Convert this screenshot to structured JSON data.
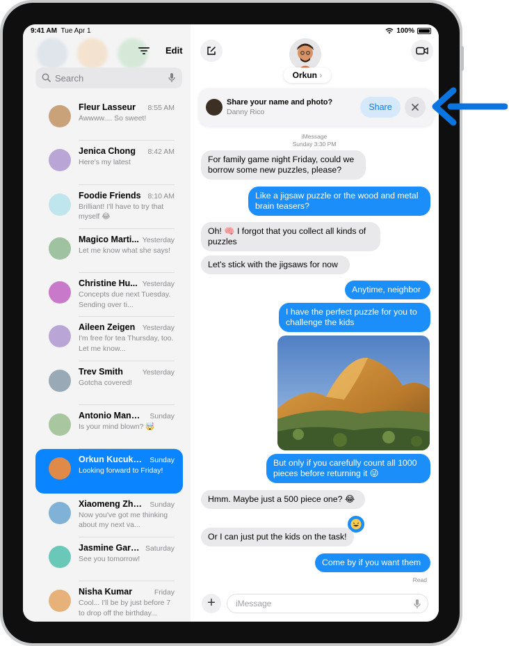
{
  "status_bar": {
    "time": "9:41 AM",
    "date": "Tue Apr 1",
    "battery": "100%"
  },
  "sidebar": {
    "edit_label": "Edit",
    "search_placeholder": "Search",
    "conversations": [
      {
        "name": "Fleur Lasseur",
        "time": "8:55 AM",
        "preview": "Awwww.... So sweet!",
        "avatar_color": "#c9a27a"
      },
      {
        "name": "Jenica Chong",
        "time": "8:42 AM",
        "preview": "Here's my latest",
        "avatar_color": "#b9a6d6"
      },
      {
        "name": "Foodie Friends",
        "time": "8:10 AM",
        "preview": "Brilliant! I'll have to try that myself 😂",
        "avatar_color": "#bfe6ec"
      },
      {
        "name": "Magico Marti...",
        "time": "Yesterday",
        "preview": "Let me know what she says!",
        "avatar_color": "#9fc2a0"
      },
      {
        "name": "Christine Hu...",
        "time": "Yesterday",
        "preview": "Concepts due next Tuesday. Sending over ti...",
        "avatar_color": "#c979c9"
      },
      {
        "name": "Aileen Zeigen",
        "time": "Yesterday",
        "preview": "I'm free for tea Thursday, too. Let me know...",
        "avatar_color": "#b9a6d6"
      },
      {
        "name": "Trev Smith",
        "time": "Yesterday",
        "preview": "Gotcha covered!",
        "avatar_color": "#9aa9b6"
      },
      {
        "name": "Antonio Manri...",
        "time": "Sunday",
        "preview": "Is your mind blown? 🤯",
        "avatar_color": "#a8c6a0"
      },
      {
        "name": "Orkun Kucukse...",
        "time": "Sunday",
        "preview": "Looking forward to Friday!",
        "avatar_color": "#e08a4a",
        "selected": true
      },
      {
        "name": "Xiaomeng Zhong",
        "time": "Sunday",
        "preview": "Now you've got me thinking about my next va...",
        "avatar_color": "#7fb2d6"
      },
      {
        "name": "Jasmine Garcia",
        "time": "Saturday",
        "preview": "See you tomorrow!",
        "avatar_color": "#6ac8b8"
      },
      {
        "name": "Nisha Kumar",
        "time": "Friday",
        "preview": "Cool... I'll be by just before 7 to drop off the birthday...",
        "avatar_color": "#e6b27a"
      }
    ]
  },
  "chat": {
    "contact_name": "Orkun",
    "share_banner": {
      "title": "Share your name and photo?",
      "subtitle": "Danny Rico",
      "share_label": "Share"
    },
    "service_label": "iMessage",
    "timestamp": "Sunday 3:30 PM",
    "messages": [
      {
        "dir": "in",
        "text": "For family game night Friday, could we borrow some new puzzles, please?"
      },
      {
        "dir": "out",
        "text": "Like a jigsaw puzzle or the wood and metal brain teasers?"
      },
      {
        "dir": "in",
        "text": "Oh! 🧠 I forgot that you collect all kinds of puzzles"
      },
      {
        "dir": "in",
        "text": "Let's stick with the jigsaws for now"
      },
      {
        "dir": "out",
        "text": "Anytime, neighbor"
      },
      {
        "dir": "out",
        "text": "I have the perfect puzzle for you to challenge the kids"
      },
      {
        "dir": "out",
        "text": "But only if you carefully count all 1000 pieces before returning it 😜"
      },
      {
        "dir": "in",
        "text": "Hmm. Maybe just a 500 piece one? 😂"
      },
      {
        "dir": "in",
        "text": "Or I can just put the kids on the task!"
      },
      {
        "dir": "out",
        "text": "Come by if you want them"
      }
    ],
    "read_label": "Read",
    "input_placeholder": "iMessage"
  },
  "colors": {
    "accent": "#0a84ff",
    "bubble_out": "#1c8ef9",
    "bubble_in": "#e9e9eb",
    "callout_arrow": "#0a74e0"
  }
}
